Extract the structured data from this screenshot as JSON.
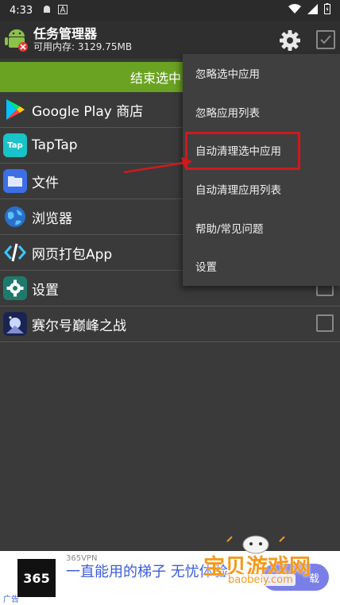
{
  "status": {
    "time": "4:33"
  },
  "header": {
    "title": "任务管理器",
    "memory": "可用内存: 3129.75MB"
  },
  "action_bar": {
    "label": "结束选中"
  },
  "apps": [
    {
      "name": "Google Play 商店",
      "icon": "google-play-icon"
    },
    {
      "name": "TapTap",
      "icon": "taptap-icon"
    },
    {
      "name": "文件",
      "icon": "folder-icon"
    },
    {
      "name": "浏览器",
      "icon": "globe-icon"
    },
    {
      "name": "网页打包App",
      "icon": "code-icon"
    },
    {
      "name": "设置",
      "icon": "settings-gear-icon"
    },
    {
      "name": "赛尔号巅峰之战",
      "icon": "game-icon"
    }
  ],
  "menu": {
    "items": [
      "忽略选中应用",
      "忽略应用列表",
      "自动清理选中应用",
      "自动清理应用列表",
      "帮助/常见问题",
      "设置"
    ]
  },
  "ad": {
    "logo": "365",
    "brand": "365VPN",
    "slogan": "一直能用的梯子 无忧体验",
    "tag": "广告",
    "button": "载"
  },
  "watermark": {
    "text": "宝贝游戏网",
    "url": "baobeiy.com"
  },
  "colors": {
    "accent_green": "#6aa321",
    "highlight_red": "#d0191c",
    "ad_blue": "#3c5dd9",
    "watermark_orange": "#f39a1e"
  }
}
